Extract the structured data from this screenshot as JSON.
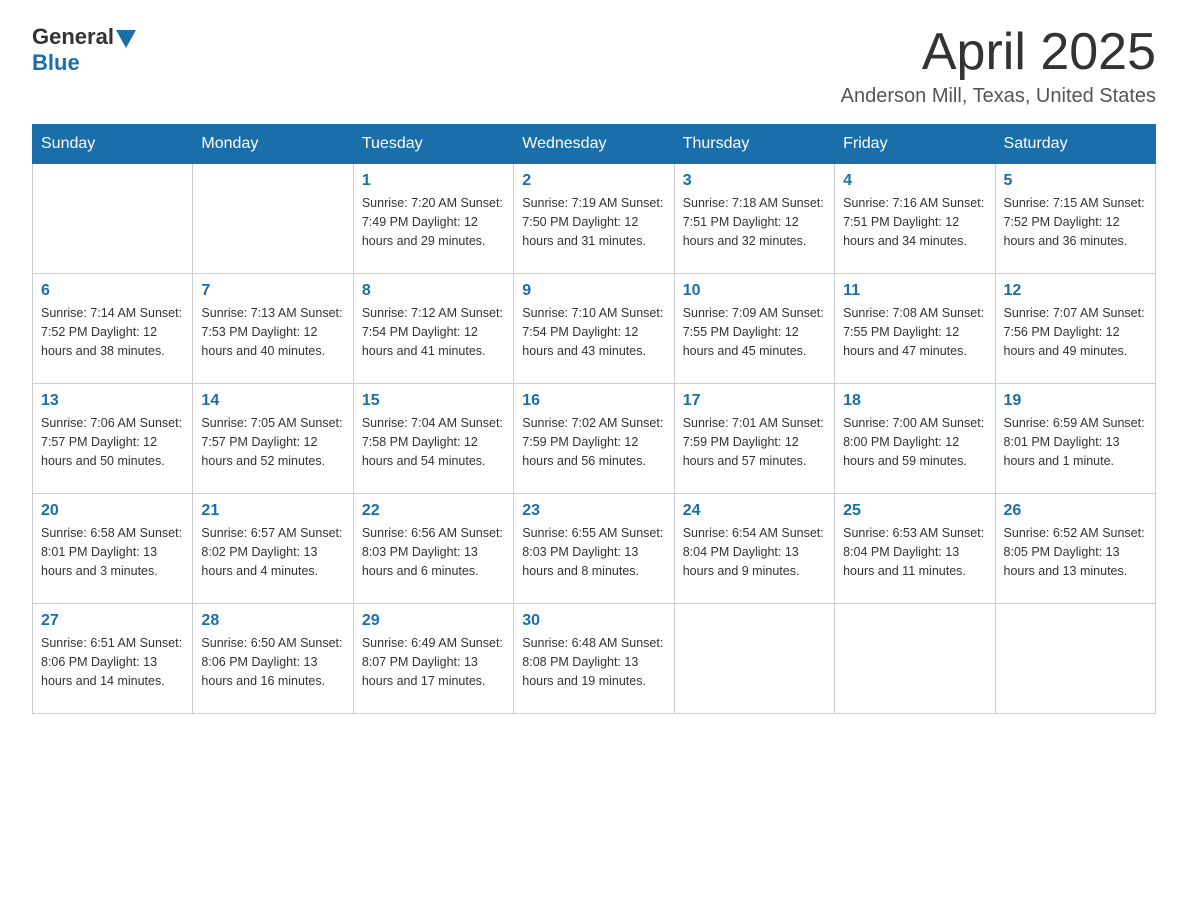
{
  "header": {
    "logo_general": "General",
    "logo_blue": "Blue",
    "month": "April 2025",
    "location": "Anderson Mill, Texas, United States"
  },
  "weekdays": [
    "Sunday",
    "Monday",
    "Tuesday",
    "Wednesday",
    "Thursday",
    "Friday",
    "Saturday"
  ],
  "weeks": [
    [
      {
        "day": "",
        "info": ""
      },
      {
        "day": "",
        "info": ""
      },
      {
        "day": "1",
        "info": "Sunrise: 7:20 AM\nSunset: 7:49 PM\nDaylight: 12 hours\nand 29 minutes."
      },
      {
        "day": "2",
        "info": "Sunrise: 7:19 AM\nSunset: 7:50 PM\nDaylight: 12 hours\nand 31 minutes."
      },
      {
        "day": "3",
        "info": "Sunrise: 7:18 AM\nSunset: 7:51 PM\nDaylight: 12 hours\nand 32 minutes."
      },
      {
        "day": "4",
        "info": "Sunrise: 7:16 AM\nSunset: 7:51 PM\nDaylight: 12 hours\nand 34 minutes."
      },
      {
        "day": "5",
        "info": "Sunrise: 7:15 AM\nSunset: 7:52 PM\nDaylight: 12 hours\nand 36 minutes."
      }
    ],
    [
      {
        "day": "6",
        "info": "Sunrise: 7:14 AM\nSunset: 7:52 PM\nDaylight: 12 hours\nand 38 minutes."
      },
      {
        "day": "7",
        "info": "Sunrise: 7:13 AM\nSunset: 7:53 PM\nDaylight: 12 hours\nand 40 minutes."
      },
      {
        "day": "8",
        "info": "Sunrise: 7:12 AM\nSunset: 7:54 PM\nDaylight: 12 hours\nand 41 minutes."
      },
      {
        "day": "9",
        "info": "Sunrise: 7:10 AM\nSunset: 7:54 PM\nDaylight: 12 hours\nand 43 minutes."
      },
      {
        "day": "10",
        "info": "Sunrise: 7:09 AM\nSunset: 7:55 PM\nDaylight: 12 hours\nand 45 minutes."
      },
      {
        "day": "11",
        "info": "Sunrise: 7:08 AM\nSunset: 7:55 PM\nDaylight: 12 hours\nand 47 minutes."
      },
      {
        "day": "12",
        "info": "Sunrise: 7:07 AM\nSunset: 7:56 PM\nDaylight: 12 hours\nand 49 minutes."
      }
    ],
    [
      {
        "day": "13",
        "info": "Sunrise: 7:06 AM\nSunset: 7:57 PM\nDaylight: 12 hours\nand 50 minutes."
      },
      {
        "day": "14",
        "info": "Sunrise: 7:05 AM\nSunset: 7:57 PM\nDaylight: 12 hours\nand 52 minutes."
      },
      {
        "day": "15",
        "info": "Sunrise: 7:04 AM\nSunset: 7:58 PM\nDaylight: 12 hours\nand 54 minutes."
      },
      {
        "day": "16",
        "info": "Sunrise: 7:02 AM\nSunset: 7:59 PM\nDaylight: 12 hours\nand 56 minutes."
      },
      {
        "day": "17",
        "info": "Sunrise: 7:01 AM\nSunset: 7:59 PM\nDaylight: 12 hours\nand 57 minutes."
      },
      {
        "day": "18",
        "info": "Sunrise: 7:00 AM\nSunset: 8:00 PM\nDaylight: 12 hours\nand 59 minutes."
      },
      {
        "day": "19",
        "info": "Sunrise: 6:59 AM\nSunset: 8:01 PM\nDaylight: 13 hours\nand 1 minute."
      }
    ],
    [
      {
        "day": "20",
        "info": "Sunrise: 6:58 AM\nSunset: 8:01 PM\nDaylight: 13 hours\nand 3 minutes."
      },
      {
        "day": "21",
        "info": "Sunrise: 6:57 AM\nSunset: 8:02 PM\nDaylight: 13 hours\nand 4 minutes."
      },
      {
        "day": "22",
        "info": "Sunrise: 6:56 AM\nSunset: 8:03 PM\nDaylight: 13 hours\nand 6 minutes."
      },
      {
        "day": "23",
        "info": "Sunrise: 6:55 AM\nSunset: 8:03 PM\nDaylight: 13 hours\nand 8 minutes."
      },
      {
        "day": "24",
        "info": "Sunrise: 6:54 AM\nSunset: 8:04 PM\nDaylight: 13 hours\nand 9 minutes."
      },
      {
        "day": "25",
        "info": "Sunrise: 6:53 AM\nSunset: 8:04 PM\nDaylight: 13 hours\nand 11 minutes."
      },
      {
        "day": "26",
        "info": "Sunrise: 6:52 AM\nSunset: 8:05 PM\nDaylight: 13 hours\nand 13 minutes."
      }
    ],
    [
      {
        "day": "27",
        "info": "Sunrise: 6:51 AM\nSunset: 8:06 PM\nDaylight: 13 hours\nand 14 minutes."
      },
      {
        "day": "28",
        "info": "Sunrise: 6:50 AM\nSunset: 8:06 PM\nDaylight: 13 hours\nand 16 minutes."
      },
      {
        "day": "29",
        "info": "Sunrise: 6:49 AM\nSunset: 8:07 PM\nDaylight: 13 hours\nand 17 minutes."
      },
      {
        "day": "30",
        "info": "Sunrise: 6:48 AM\nSunset: 8:08 PM\nDaylight: 13 hours\nand 19 minutes."
      },
      {
        "day": "",
        "info": ""
      },
      {
        "day": "",
        "info": ""
      },
      {
        "day": "",
        "info": ""
      }
    ]
  ]
}
